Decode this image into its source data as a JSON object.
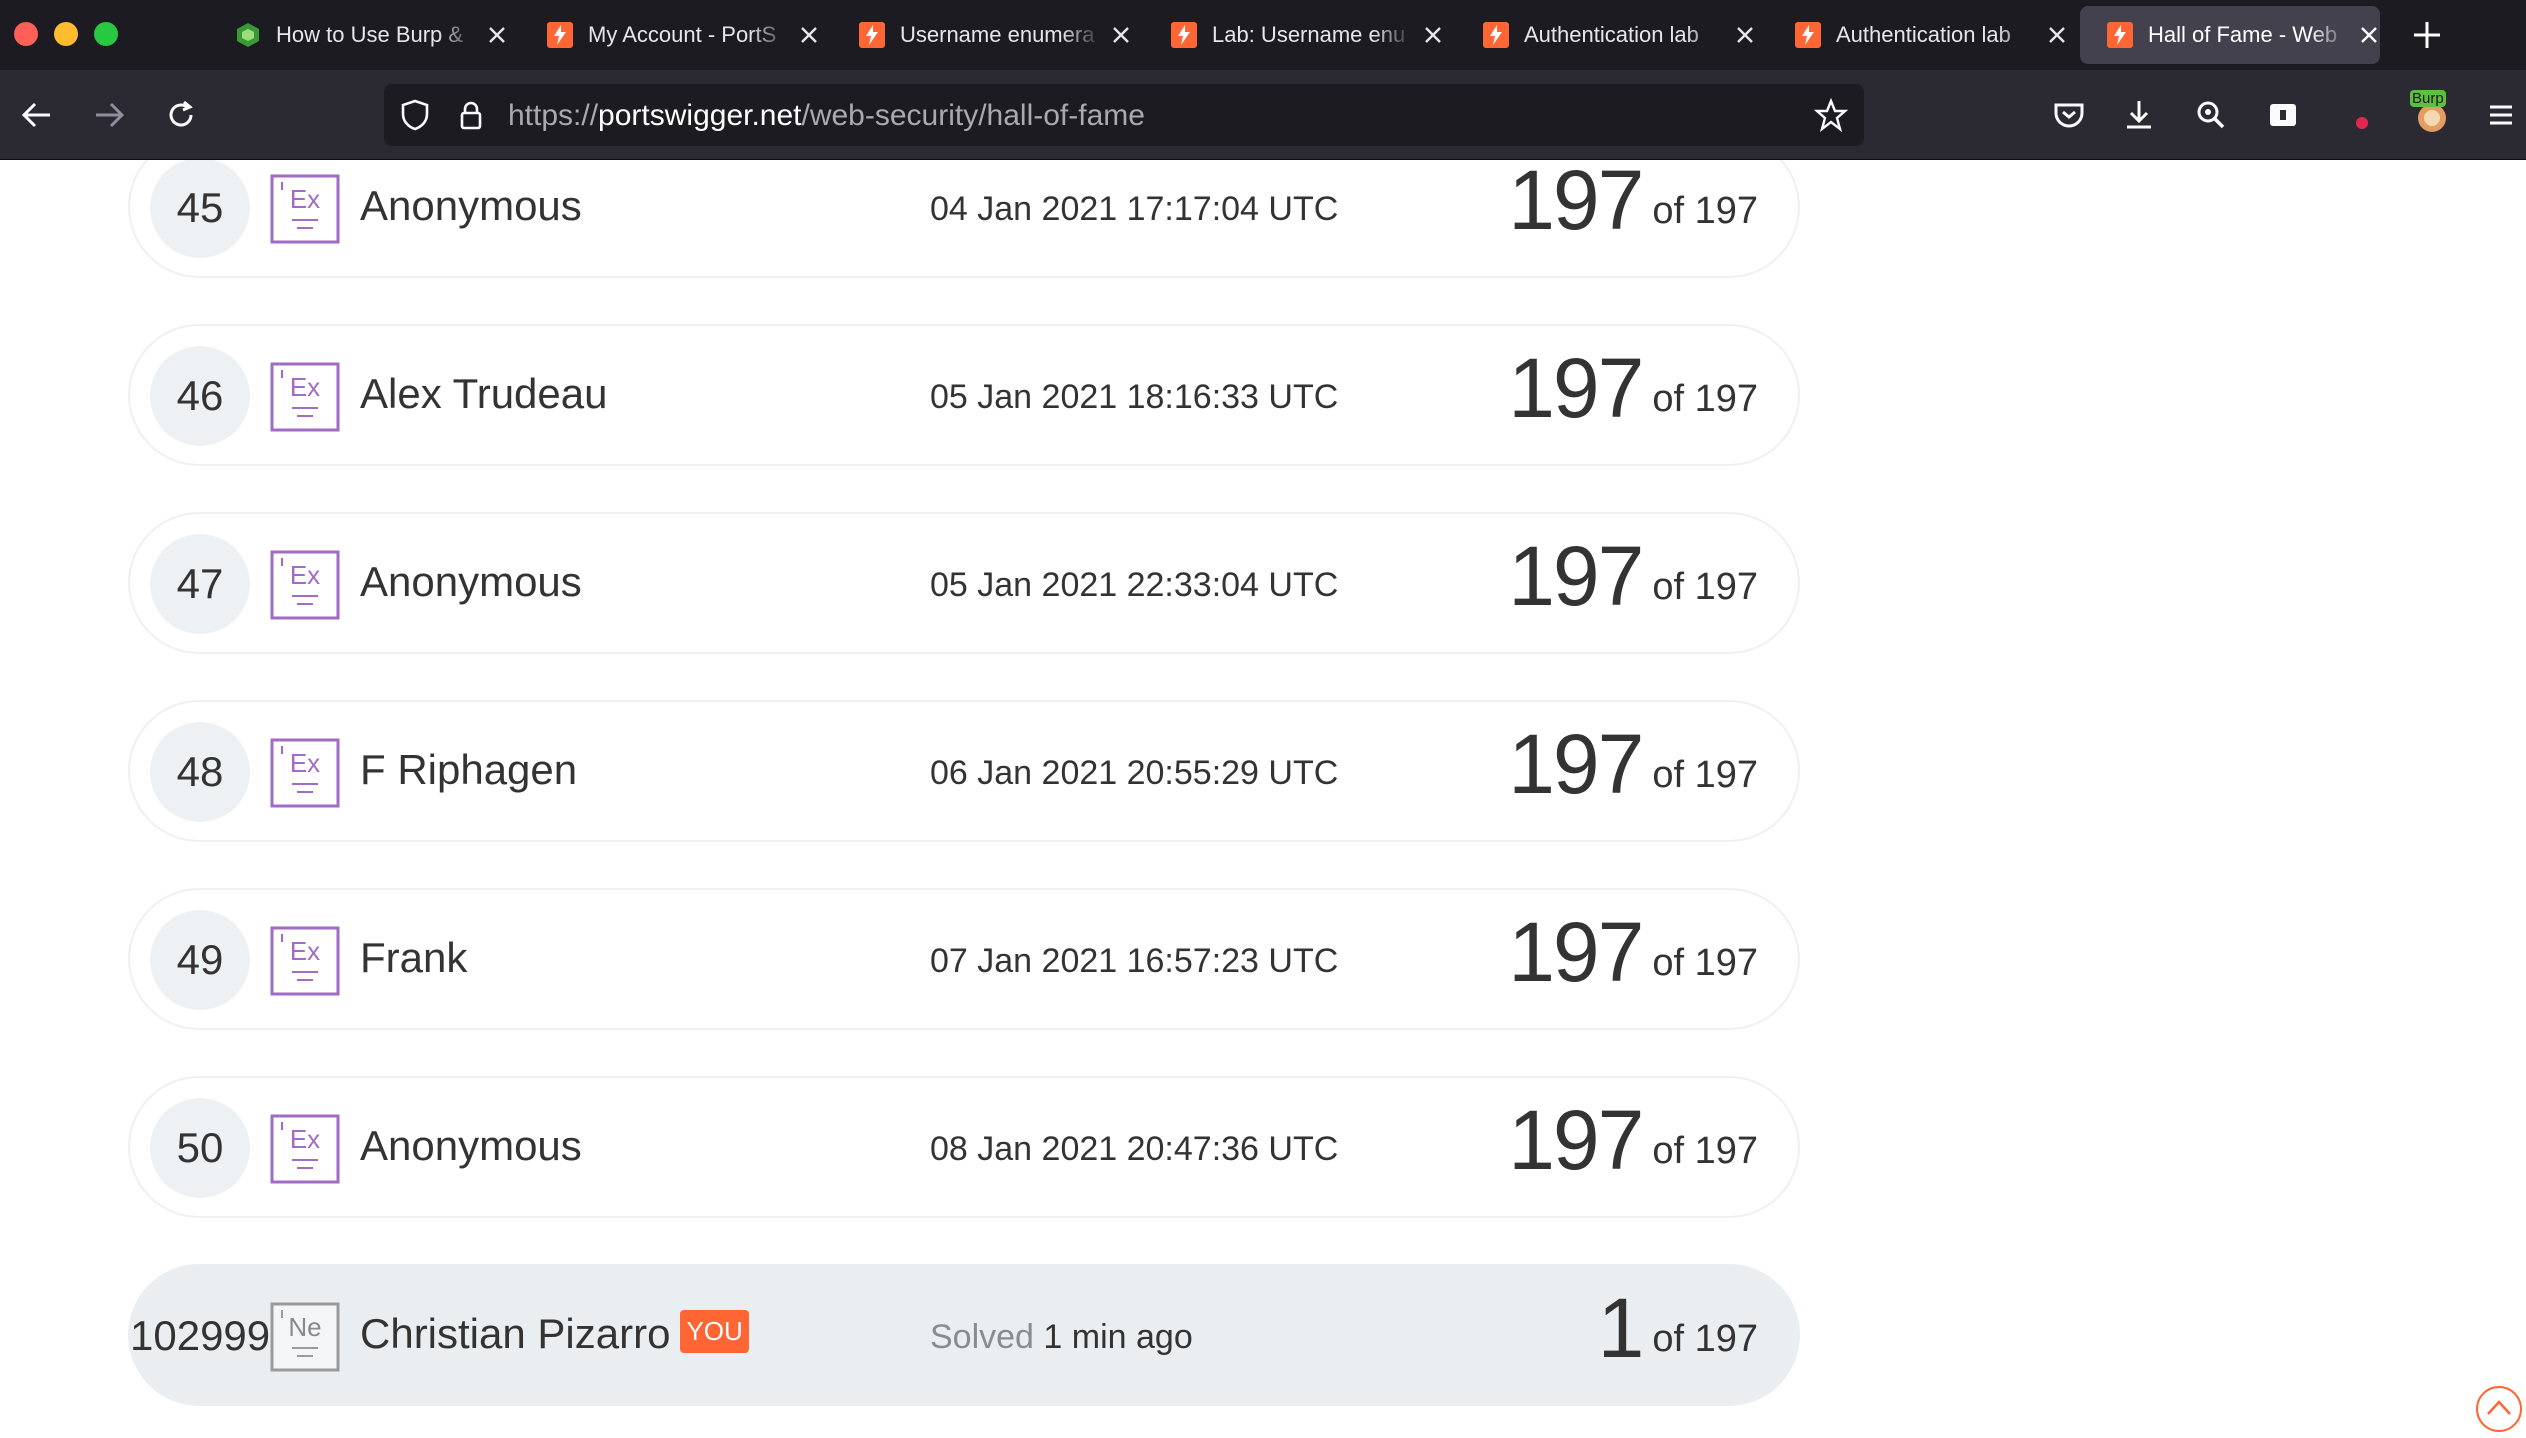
{
  "browser": {
    "tabs": [
      {
        "title": "How to Use Burp & ",
        "favicon": "burp-green-icon",
        "active": false
      },
      {
        "title": "My Account - PortS",
        "favicon": "portswigger-icon",
        "active": false
      },
      {
        "title": "Username enumera",
        "favicon": "portswigger-icon",
        "active": false
      },
      {
        "title": "Lab: Username enu",
        "favicon": "portswigger-icon",
        "active": false
      },
      {
        "title": "Authentication lab",
        "favicon": "portswigger-icon",
        "active": false
      },
      {
        "title": "Authentication lab",
        "favicon": "portswigger-icon",
        "active": false
      },
      {
        "title": "Hall of Fame - Web",
        "favicon": "portswigger-icon",
        "active": true
      }
    ],
    "url": {
      "scheme": "https://",
      "host": "portswigger.net",
      "path": "/web-security/hall-of-fame"
    },
    "extension_badge": "Burp"
  },
  "leaderboard": {
    "total_label": "of 197",
    "rows": [
      {
        "rank": "45",
        "level": "Ex",
        "name": "Anonymous",
        "date": "04 Jan 2021 17:17:04 UTC",
        "solved": "197"
      },
      {
        "rank": "46",
        "level": "Ex",
        "name": "Alex Trudeau",
        "date": "05 Jan 2021 18:16:33 UTC",
        "solved": "197"
      },
      {
        "rank": "47",
        "level": "Ex",
        "name": "Anonymous",
        "date": "05 Jan 2021 22:33:04 UTC",
        "solved": "197"
      },
      {
        "rank": "48",
        "level": "Ex",
        "name": "F Riphagen",
        "date": "06 Jan 2021 20:55:29 UTC",
        "solved": "197"
      },
      {
        "rank": "49",
        "level": "Ex",
        "name": "Frank",
        "date": "07 Jan 2021 16:57:23 UTC",
        "solved": "197"
      },
      {
        "rank": "50",
        "level": "Ex",
        "name": "Anonymous",
        "date": "08 Jan 2021 20:47:36 UTC",
        "solved": "197"
      }
    ],
    "me": {
      "rank": "102999",
      "level": "Ne",
      "name": "Christian Pizarro",
      "you_label": "YOU",
      "solved_prefix": "Solved",
      "solved_when": "1 min ago",
      "solved": "1"
    }
  },
  "colors": {
    "expert_badge": "#a26bc4",
    "newbie_badge": "#9a9a9a",
    "you_badge": "#ff6633",
    "portswigger_orange": "#ff6633"
  }
}
